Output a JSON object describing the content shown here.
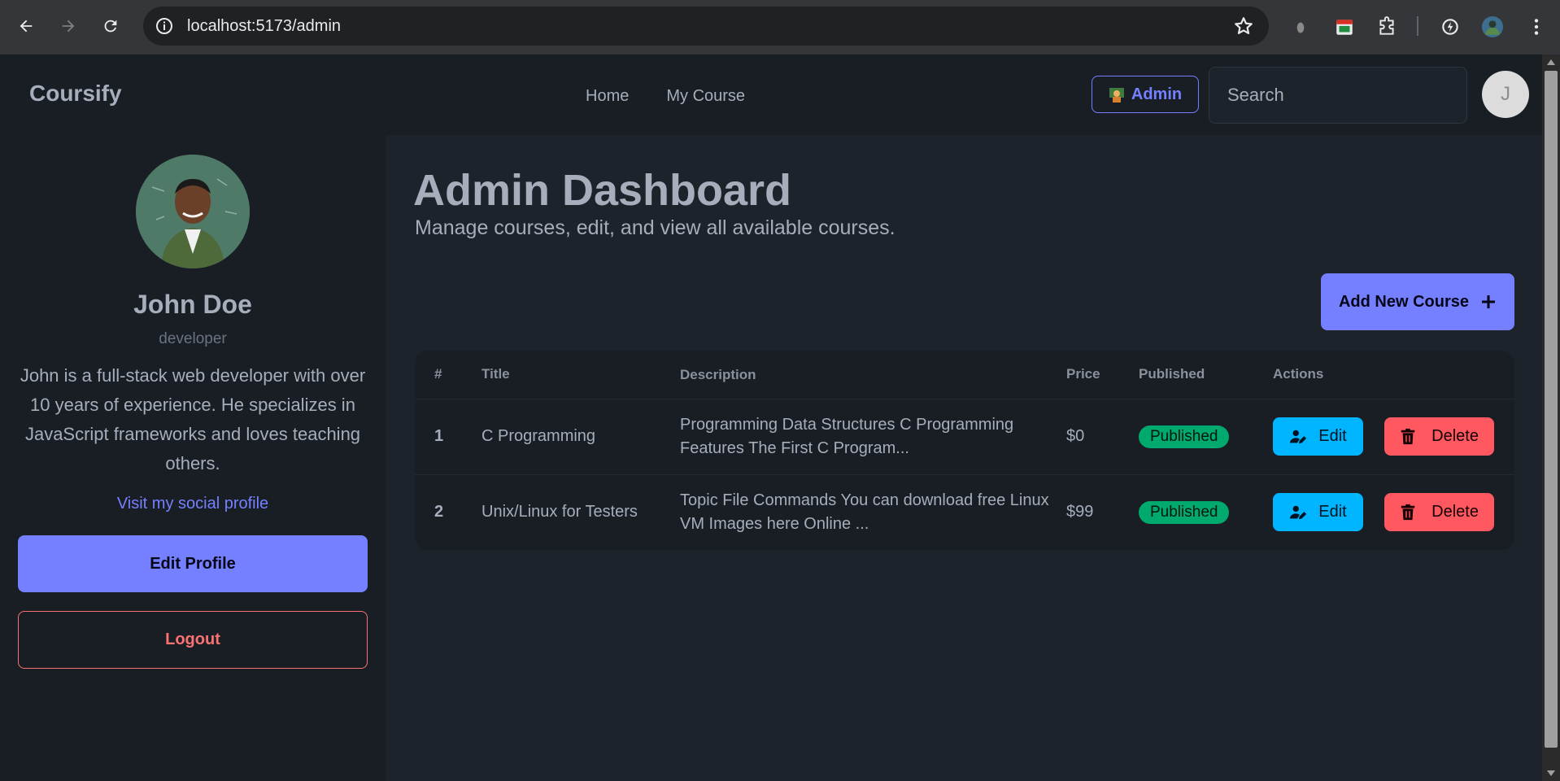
{
  "browser": {
    "url": "localhost:5173/admin"
  },
  "navbar": {
    "brand": "Coursify",
    "links": [
      "Home",
      "My Course"
    ],
    "admin_label": "Admin",
    "search_placeholder": "Search",
    "avatar_initial": "J"
  },
  "profile": {
    "name": "John Doe",
    "role": "developer",
    "bio": "John is a full-stack web developer with over 10 years of experience. He specializes in JavaScript frameworks and loves teaching others.",
    "social_link": "Visit my social profile",
    "edit_label": "Edit Profile",
    "logout_label": "Logout"
  },
  "main": {
    "title": "Admin Dashboard",
    "subtitle": "Manage courses, edit, and view all available courses.",
    "add_label": "Add New Course"
  },
  "table": {
    "headers": [
      "#",
      "Title",
      "Description",
      "Price",
      "Published",
      "Actions"
    ],
    "rows": [
      {
        "index": "1",
        "title": "C Programming",
        "description": "Programming Data Structures C Programming Features The First C Program...",
        "price": "$0",
        "status": "Published",
        "edit_label": "Edit",
        "delete_label": "Delete"
      },
      {
        "index": "2",
        "title": "Unix/Linux for Testers",
        "description": "Topic File Commands You can download free Linux VM Images here Online ...",
        "price": "$99",
        "status": "Published",
        "edit_label": "Edit",
        "delete_label": "Delete"
      }
    ]
  },
  "colors": {
    "primary": "#7480ff",
    "info": "#00b5ff",
    "error": "#ff5861",
    "success": "#00a96e",
    "background": "#1d232a",
    "panel": "#191e24"
  }
}
